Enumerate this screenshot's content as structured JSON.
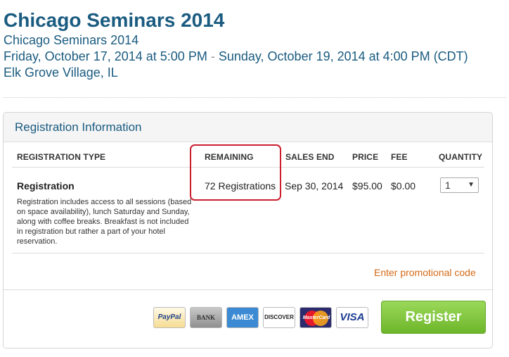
{
  "event": {
    "title": "Chicago Seminars 2014",
    "subtitle": "Chicago Seminars 2014",
    "start": "Friday, October 17, 2014 at 5:00 PM",
    "separator": " - ",
    "end": "Sunday, October 19, 2014 at 4:00 PM (CDT)",
    "location": "Elk Grove Village, IL"
  },
  "panel": {
    "heading": "Registration Information",
    "columns": {
      "type": "REGISTRATION TYPE",
      "remaining": "REMAINING",
      "sales_end": "SALES END",
      "price": "PRICE",
      "fee": "FEE",
      "quantity": "QUANTITY"
    },
    "ticket": {
      "name": "Registration",
      "description": "Registration includes access to all sessions (based on space availability), lunch Saturday and Sunday, along with coffee breaks. Breakfast is not included in registration but rather a part of your hotel reservation.",
      "remaining": "72 Registrations",
      "sales_end": "Sep 30, 2014",
      "price": "$95.00",
      "fee": "$0.00",
      "quantity": "1"
    },
    "promo_label": "Enter promotional code",
    "register_label": "Register"
  },
  "payment_methods": [
    {
      "name": "PayPal",
      "icon": "paypal-icon"
    },
    {
      "name": "BANK",
      "icon": "bank-icon"
    },
    {
      "name": "AMEX",
      "icon": "amex-icon"
    },
    {
      "name": "DISCOVER",
      "icon": "discover-icon"
    },
    {
      "name": "MasterCard",
      "icon": "mastercard-icon"
    },
    {
      "name": "VISA",
      "icon": "visa-icon"
    }
  ],
  "colors": {
    "title": "#1a5b80",
    "promo": "#d46a17",
    "register": "#7cc33a",
    "highlight": "#cc1f2e"
  }
}
